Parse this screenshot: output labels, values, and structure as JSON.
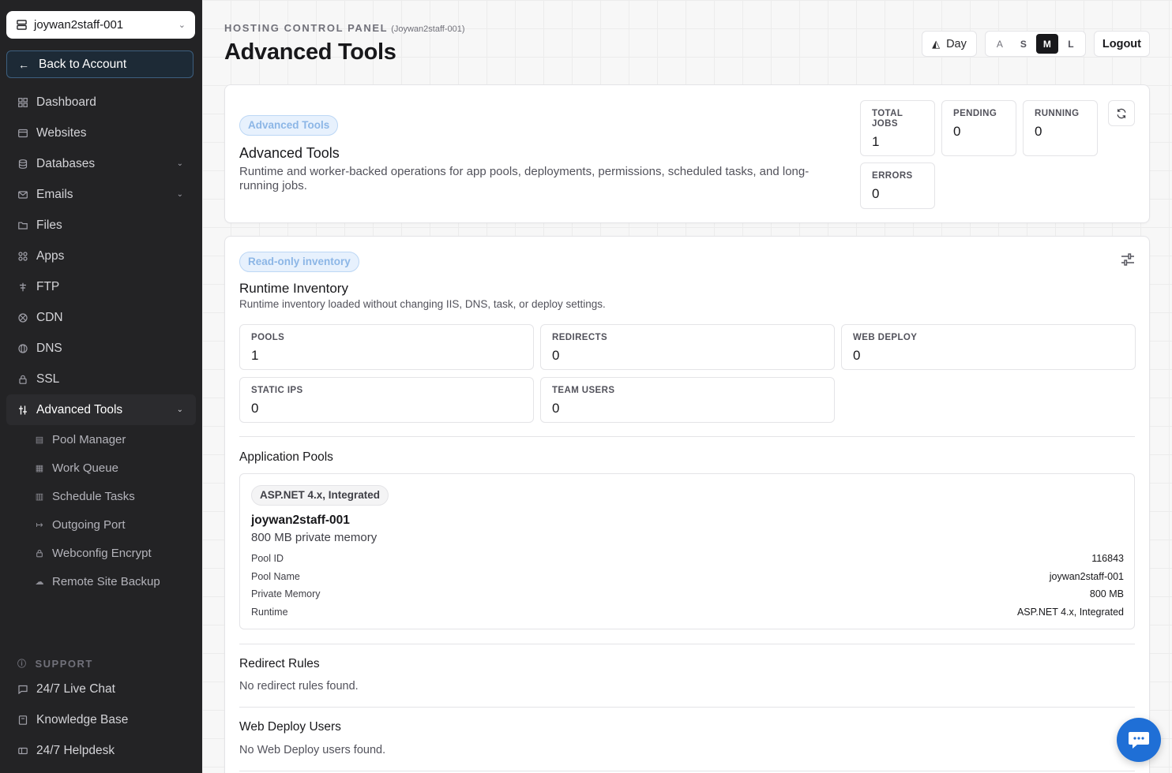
{
  "sidebar": {
    "account": "joywan2staff-001",
    "back_label": "Back to Account",
    "items": [
      {
        "label": "Dashboard"
      },
      {
        "label": "Websites"
      },
      {
        "label": "Databases"
      },
      {
        "label": "Emails"
      },
      {
        "label": "Files"
      },
      {
        "label": "Apps"
      },
      {
        "label": "FTP"
      },
      {
        "label": "CDN"
      },
      {
        "label": "DNS"
      },
      {
        "label": "SSL"
      },
      {
        "label": "Advanced Tools"
      }
    ],
    "sub_items": [
      {
        "label": "Pool Manager"
      },
      {
        "label": "Work Queue"
      },
      {
        "label": "Schedule Tasks"
      },
      {
        "label": "Outgoing Port"
      },
      {
        "label": "Webconfig Encrypt"
      },
      {
        "label": "Remote Site Backup"
      }
    ],
    "support_heading": "SUPPORT",
    "support_items": [
      {
        "label": "24/7 Live Chat"
      },
      {
        "label": "Knowledge Base"
      },
      {
        "label": "24/7 Helpdesk"
      }
    ]
  },
  "header": {
    "eyebrow": "HOSTING CONTROL PANEL",
    "account_tag": "(Joywan2staff-001)",
    "title": "Advanced Tools",
    "day_label": "Day",
    "sizes": [
      "S",
      "M",
      "L"
    ],
    "logout_label": "Logout"
  },
  "overview": {
    "badge": "Advanced Tools",
    "title": "Advanced Tools",
    "description": "Runtime and worker-backed operations for app pools, deployments, permissions, scheduled tasks, and long-running jobs.",
    "stats": [
      {
        "label": "TOTAL JOBS",
        "value": "1"
      },
      {
        "label": "PENDING",
        "value": "0"
      },
      {
        "label": "RUNNING",
        "value": "0"
      },
      {
        "label": "ERRORS",
        "value": "0"
      }
    ]
  },
  "inventory": {
    "badge": "Read-only inventory",
    "title": "Runtime Inventory",
    "description": "Runtime inventory loaded without changing IIS, DNS, task, or deploy settings.",
    "counts": [
      {
        "label": "POOLS",
        "value": "1"
      },
      {
        "label": "REDIRECTS",
        "value": "0"
      },
      {
        "label": "WEB DEPLOY",
        "value": "0"
      },
      {
        "label": "STATIC IPS",
        "value": "0"
      },
      {
        "label": "TEAM USERS",
        "value": "0"
      }
    ],
    "pools_heading": "Application Pools",
    "pool": {
      "badge": "ASP.NET 4.x, Integrated",
      "name": "joywan2staff-001",
      "memory_summary": "800 MB private memory",
      "rows": [
        {
          "key": "Pool ID",
          "value": "116843"
        },
        {
          "key": "Pool Name",
          "value": "joywan2staff-001"
        },
        {
          "key": "Private Memory",
          "value": "800 MB"
        },
        {
          "key": "Runtime",
          "value": "ASP.NET 4.x, Integrated"
        }
      ]
    },
    "redirects_heading": "Redirect Rules",
    "redirects_empty": "No redirect rules found.",
    "webdeploy_heading": "Web Deploy Users",
    "webdeploy_empty": "No Web Deploy users found."
  }
}
